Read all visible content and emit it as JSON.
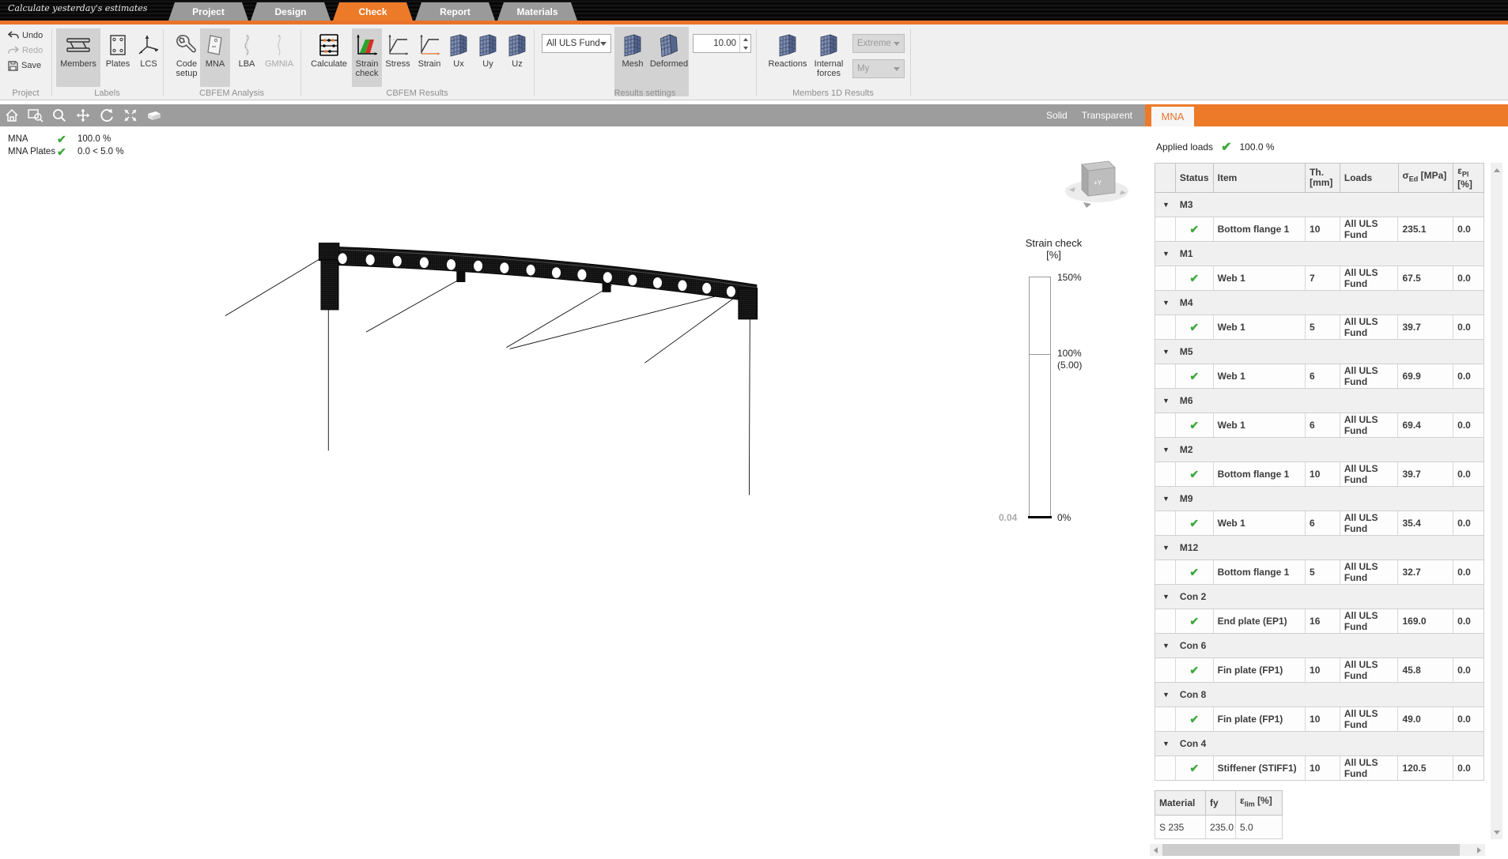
{
  "window": {
    "title": "Calculate yesterday's estimates"
  },
  "tabs": [
    {
      "label": "Project"
    },
    {
      "label": "Design"
    },
    {
      "label": "Check",
      "active": true
    },
    {
      "label": "Report"
    },
    {
      "label": "Materials"
    }
  ],
  "ribbon": {
    "project": {
      "label": "Project",
      "undo": "Undo",
      "redo": "Redo",
      "save": "Save"
    },
    "labels": {
      "label": "Labels",
      "members": "Members",
      "plates": "Plates",
      "lcs": "LCS"
    },
    "cbfem_analysis": {
      "label": "CBFEM Analysis",
      "code_setup": "Code setup",
      "mna": "MNA",
      "lba": "LBA",
      "gmnia": "GMNIA"
    },
    "cbfem_results": {
      "label": "CBFEM Results",
      "calculate": "Calculate",
      "strain_check": "Strain check",
      "stress": "Stress",
      "strain": "Strain",
      "ux": "Ux",
      "uy": "Uy",
      "uz": "Uz"
    },
    "results_settings": {
      "label": "Results settings",
      "load_case": "All ULS Fund",
      "mesh": "Mesh",
      "deformed": "Deformed",
      "scale": "10.00"
    },
    "members_1d": {
      "label": "Members 1D Results",
      "reactions": "Reactions",
      "internal_forces": "Internal forces",
      "extreme": "Extreme",
      "my": "My"
    }
  },
  "viewport": {
    "toolbar": {
      "solid": "Solid",
      "transparent": "Transparent"
    },
    "status": [
      {
        "label": "MNA",
        "value": "100.0 %"
      },
      {
        "label": "MNA Plates",
        "value": "0.0 < 5.0 %"
      }
    ],
    "nav_cube_label": "+Y",
    "legend": {
      "title": "Strain check",
      "unit": "[%]",
      "max": "150%",
      "mid": "100%",
      "mid_sub": "(5.00)",
      "min": "0%",
      "current": "0.04"
    }
  },
  "panel": {
    "tab": "MNA",
    "applied_loads": {
      "label": "Applied loads",
      "value": "100.0 %"
    },
    "table": {
      "headers": {
        "status": "Status",
        "item": "Item",
        "th_line1": "Th.",
        "th_line2": "[mm]",
        "loads": "Loads",
        "sigma": "σ",
        "sigma_sub": "Ed",
        "sigma_unit": "[MPa]",
        "eps": "ε",
        "eps_sub": "Pl",
        "eps_unit": "[%]"
      },
      "groups": [
        {
          "name": "M3",
          "rows": [
            {
              "item": "Bottom flange 1",
              "th": "10",
              "loads": "All ULS Fund",
              "sigma": "235.1",
              "eps": "0.0"
            }
          ]
        },
        {
          "name": "M1",
          "rows": [
            {
              "item": "Web 1",
              "th": "7",
              "loads": "All ULS Fund",
              "sigma": "67.5",
              "eps": "0.0"
            }
          ]
        },
        {
          "name": "M4",
          "rows": [
            {
              "item": "Web 1",
              "th": "5",
              "loads": "All ULS Fund",
              "sigma": "39.7",
              "eps": "0.0"
            }
          ]
        },
        {
          "name": "M5",
          "rows": [
            {
              "item": "Web 1",
              "th": "6",
              "loads": "All ULS Fund",
              "sigma": "69.9",
              "eps": "0.0"
            }
          ]
        },
        {
          "name": "M6",
          "rows": [
            {
              "item": "Web 1",
              "th": "6",
              "loads": "All ULS Fund",
              "sigma": "69.4",
              "eps": "0.0"
            }
          ]
        },
        {
          "name": "M2",
          "rows": [
            {
              "item": "Bottom flange 1",
              "th": "10",
              "loads": "All ULS Fund",
              "sigma": "39.7",
              "eps": "0.0"
            }
          ]
        },
        {
          "name": "M9",
          "rows": [
            {
              "item": "Web 1",
              "th": "6",
              "loads": "All ULS Fund",
              "sigma": "35.4",
              "eps": "0.0"
            }
          ]
        },
        {
          "name": "M12",
          "rows": [
            {
              "item": "Bottom flange 1",
              "th": "5",
              "loads": "All ULS Fund",
              "sigma": "32.7",
              "eps": "0.0"
            }
          ]
        },
        {
          "name": "Con 2",
          "rows": [
            {
              "item": "End plate (EP1)",
              "th": "16",
              "loads": "All ULS Fund",
              "sigma": "169.0",
              "eps": "0.0"
            }
          ]
        },
        {
          "name": "Con 6",
          "rows": [
            {
              "item": "Fin plate (FP1)",
              "th": "10",
              "loads": "All ULS Fund",
              "sigma": "45.8",
              "eps": "0.0"
            }
          ]
        },
        {
          "name": "Con 8",
          "rows": [
            {
              "item": "Fin plate (FP1)",
              "th": "10",
              "loads": "All ULS Fund",
              "sigma": "49.0",
              "eps": "0.0"
            }
          ]
        },
        {
          "name": "Con 4",
          "rows": [
            {
              "item": "Stiffener (STIFF1)",
              "th": "10",
              "loads": "All ULS Fund",
              "sigma": "120.5",
              "eps": "0.0"
            }
          ]
        }
      ]
    },
    "material_table": {
      "headers": {
        "material": "Material",
        "fy": "fy",
        "eps": "ε",
        "eps_sub": "lim",
        "eps_unit": "[%]"
      },
      "rows": [
        {
          "material": "S 235",
          "fy": "235.0",
          "eps": "5.0"
        }
      ]
    }
  },
  "colors": {
    "accent": "#EC7A28",
    "check_green": "#3DA83D",
    "toolbar_gray": "#9D9D9D"
  }
}
